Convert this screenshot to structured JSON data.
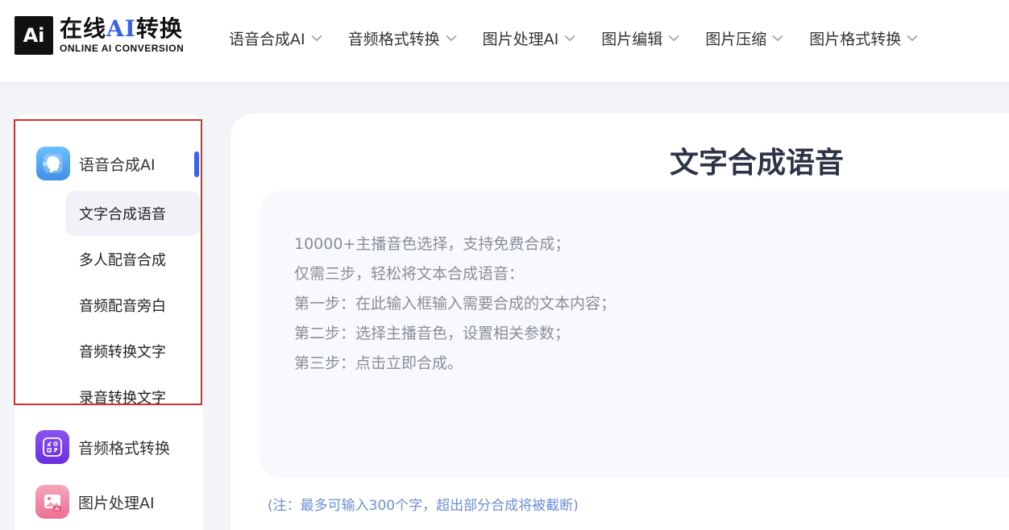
{
  "logo": {
    "mark": "Ai",
    "cn_prefix": "在线",
    "cn_ai": "AI",
    "cn_suffix": "转换",
    "en": "ONLINE AI CONVERSION"
  },
  "nav": {
    "items": [
      {
        "label": "语音合成AI"
      },
      {
        "label": "音频格式转换"
      },
      {
        "label": "图片处理AI"
      },
      {
        "label": "图片编辑"
      },
      {
        "label": "图片压缩"
      },
      {
        "label": "图片格式转换"
      }
    ]
  },
  "sidebar": {
    "categories": [
      {
        "label": "语音合成AI",
        "icon": "voice-head-icon",
        "color": "#4aa3f0"
      },
      {
        "label": "音频格式转换",
        "icon": "audio-convert-icon",
        "color": "#7b3fe4"
      },
      {
        "label": "图片处理AI",
        "icon": "image-ai-icon",
        "color": "#f07a9a"
      }
    ],
    "sub_items": [
      {
        "label": "文字合成语音",
        "active": true
      },
      {
        "label": "多人配音合成"
      },
      {
        "label": "音频配音旁白"
      },
      {
        "label": "音频转换文字"
      },
      {
        "label": "录音转换文字"
      }
    ]
  },
  "main": {
    "title": "文字合成语音",
    "instructions": [
      "10000+主播音色选择，支持免费合成；",
      "仅需三步，轻松将文本合成语音：",
      "第一步：在此输入框输入需要合成的文本内容；",
      "第二步：选择主播音色，设置相关参数；",
      "第三步：点击立即合成。"
    ],
    "note": "(注：最多可输入300个字，超出部分合成将被截断)"
  },
  "colors": {
    "accent": "#3b63f0",
    "selection_outline": "#d32f2f",
    "note_text": "#6b8fd6"
  }
}
